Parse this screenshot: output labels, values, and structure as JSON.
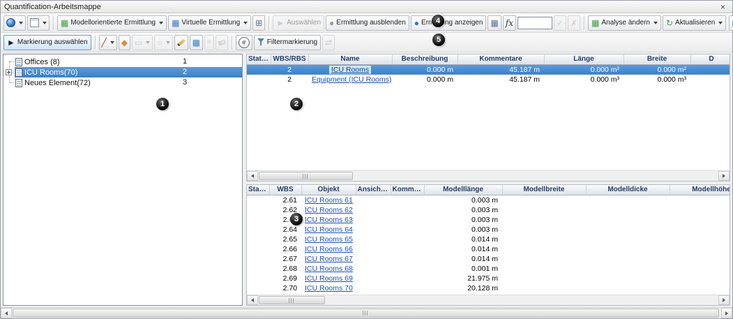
{
  "window": {
    "title": "Quantification-Arbeitsmappe"
  },
  "icons": {
    "close": "×",
    "grid": "▦",
    "box": "⊞",
    "cursor": "►",
    "circle": "●",
    "check": "✓",
    "cross": "✗",
    "fx": "fx",
    "refresh": "↻",
    "export": "▤",
    "line": "╱",
    "fill": "◆",
    "rect": "▭",
    "ellipse": "○",
    "style_lines": "≡",
    "link_arrows": "⇄",
    "hash": "#"
  },
  "toolbar_main": {
    "model_takeoff_label": "Modellorientierte Ermittlung",
    "virtual_takeoff_label": "Virtuelle Ermittlung",
    "select_label": "Auswählen",
    "hide_label": "Ermittlung ausblenden",
    "show_label": "Ermittlung anzeigen",
    "formula_value": "",
    "change_analysis_label": "Analyse ändern",
    "update_label": "Aktualisieren"
  },
  "toolbar_markup": {
    "select_markup_label": "Markierung auswählen",
    "filter_markup_label": "Filtermarkierung"
  },
  "tree": {
    "items": [
      {
        "label": "Offices (8)",
        "index": "1",
        "selected": false,
        "expandable": false
      },
      {
        "label": "ICU Rooms(70)",
        "index": "2",
        "selected": true,
        "expandable": true
      },
      {
        "label": "Neues Element(72)",
        "index": "3",
        "selected": false,
        "expandable": false
      }
    ]
  },
  "upper_table": {
    "columns": [
      "Status",
      "WBS/RBS",
      "Name",
      "Beschreibung",
      "Kommentare",
      "Länge",
      "Breite",
      "D"
    ],
    "rows": [
      {
        "status": "",
        "wbs": "2",
        "name": "ICU Rooms",
        "beschreibung": "0.000 m",
        "kommentare": "45.187 m",
        "laenge": "0.000 m²",
        "breite": "0.000 m²",
        "selected": true
      },
      {
        "status": "",
        "wbs": "2",
        "name": "Equipment (ICU Rooms)",
        "beschreibung": "0.000 m",
        "kommentare": "45.187 m",
        "laenge": "0.000 m³",
        "breite": "0.000 m³",
        "selected": false
      }
    ]
  },
  "lower_table": {
    "columns": [
      "Status",
      "WBS",
      "Objekt",
      "Ansichtsp...",
      "Komment...",
      "Modelllänge",
      "Modellbreite",
      "Modelldicke",
      "Modellhöhe"
    ],
    "rows": [
      {
        "wbs": "2.61",
        "objekt": "ICU Rooms 61",
        "modelllaenge": "0.003 m"
      },
      {
        "wbs": "2.62",
        "objekt": "ICU Rooms 62",
        "modelllaenge": "0.003 m"
      },
      {
        "wbs": "2.63",
        "objekt": "ICU Rooms 63",
        "modelllaenge": "0.003 m"
      },
      {
        "wbs": "2.64",
        "objekt": "ICU Rooms 64",
        "modelllaenge": "0.003 m"
      },
      {
        "wbs": "2.65",
        "objekt": "ICU Rooms 65",
        "modelllaenge": "0.014 m"
      },
      {
        "wbs": "2.66",
        "objekt": "ICU Rooms 66",
        "modelllaenge": "0.014 m"
      },
      {
        "wbs": "2.67",
        "objekt": "ICU Rooms 67",
        "modelllaenge": "0.014 m"
      },
      {
        "wbs": "2.68",
        "objekt": "ICU Rooms 68",
        "modelllaenge": "0.001 m"
      },
      {
        "wbs": "2.69",
        "objekt": "ICU Rooms 69",
        "modelllaenge": "21.975 m"
      },
      {
        "wbs": "2.70",
        "objekt": "ICU Rooms 70",
        "modelllaenge": "20.128 m"
      }
    ]
  },
  "callouts": [
    "1",
    "2",
    "3",
    "4",
    "5"
  ]
}
